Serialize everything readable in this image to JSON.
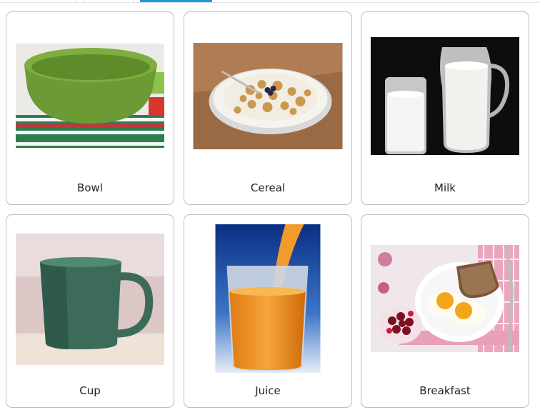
{
  "cards": [
    {
      "label": "Bowl",
      "image": "green-bowl"
    },
    {
      "label": "Cereal",
      "image": "cereal-bowl"
    },
    {
      "label": "Milk",
      "image": "milk-glass-and-jug"
    },
    {
      "label": "Cup",
      "image": "green-mug"
    },
    {
      "label": "Juice",
      "image": "orange-juice-glass"
    },
    {
      "label": "Breakfast",
      "image": "eggs-toast-plate"
    }
  ],
  "colors": {
    "active_tab": "#1a9ad9",
    "card_border": "#bdbdbd"
  }
}
